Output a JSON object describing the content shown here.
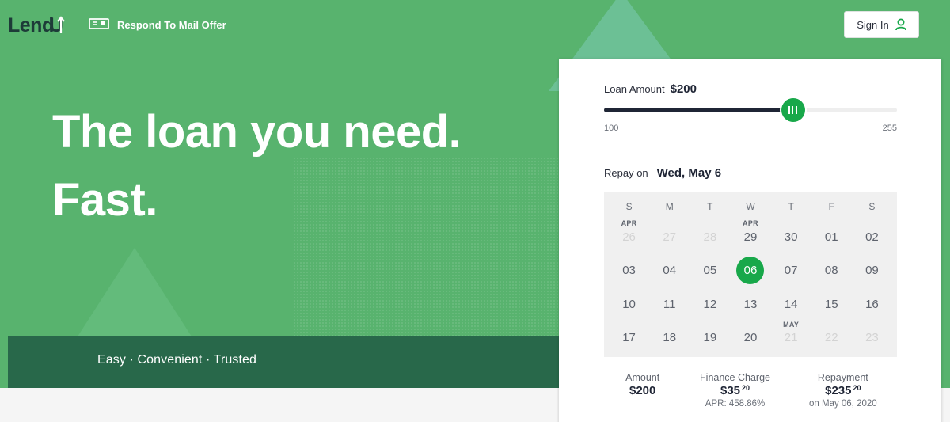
{
  "header": {
    "logo": "LendUp",
    "mail_offer_label": "Respond To Mail Offer",
    "sign_in_label": "Sign In"
  },
  "hero": {
    "headline_line1": "The loan you need.",
    "headline_line2": "Fast.",
    "tagline": "Easy · Convenient · Trusted"
  },
  "loan_card": {
    "amount_label": "Loan Amount",
    "amount_value": "$200",
    "slider": {
      "min": "100",
      "max": "255",
      "value": 200,
      "min_value": 100,
      "max_value": 255
    },
    "repay_label": "Repay on",
    "repay_value": "Wed, May 6",
    "calendar": {
      "weekdays": [
        "S",
        "M",
        "T",
        "W",
        "T",
        "F",
        "S"
      ],
      "weeks": [
        [
          {
            "d": "26",
            "m": "APR",
            "dim": true
          },
          {
            "d": "27",
            "dim": true
          },
          {
            "d": "28",
            "dim": true
          },
          {
            "d": "29",
            "m": "APR"
          },
          {
            "d": "30"
          },
          {
            "d": "01"
          },
          {
            "d": "02"
          }
        ],
        [
          {
            "d": "03"
          },
          {
            "d": "04"
          },
          {
            "d": "05"
          },
          {
            "d": "06",
            "sel": true
          },
          {
            "d": "07"
          },
          {
            "d": "08"
          },
          {
            "d": "09"
          }
        ],
        [
          {
            "d": "10"
          },
          {
            "d": "11"
          },
          {
            "d": "12"
          },
          {
            "d": "13"
          },
          {
            "d": "14"
          },
          {
            "d": "15"
          },
          {
            "d": "16"
          }
        ],
        [
          {
            "d": "17"
          },
          {
            "d": "18"
          },
          {
            "d": "19"
          },
          {
            "d": "20"
          },
          {
            "d": "21",
            "m": "MAY",
            "dim": true
          },
          {
            "d": "22",
            "dim": true
          },
          {
            "d": "23",
            "dim": true
          }
        ]
      ]
    },
    "summary": {
      "amount_label": "Amount",
      "amount_value": "$200",
      "finance_label": "Finance Charge",
      "finance_value": "$35",
      "finance_cents": "20",
      "apr_text": "APR: 458.86%",
      "repayment_label": "Repayment",
      "repayment_value": "$235",
      "repayment_cents": "20",
      "repayment_date": "on May 06, 2020"
    }
  },
  "colors": {
    "hero_green": "#58b36e",
    "band_dark_green": "#28684a",
    "accent_green": "#18a84a",
    "navy": "#1f2535"
  }
}
